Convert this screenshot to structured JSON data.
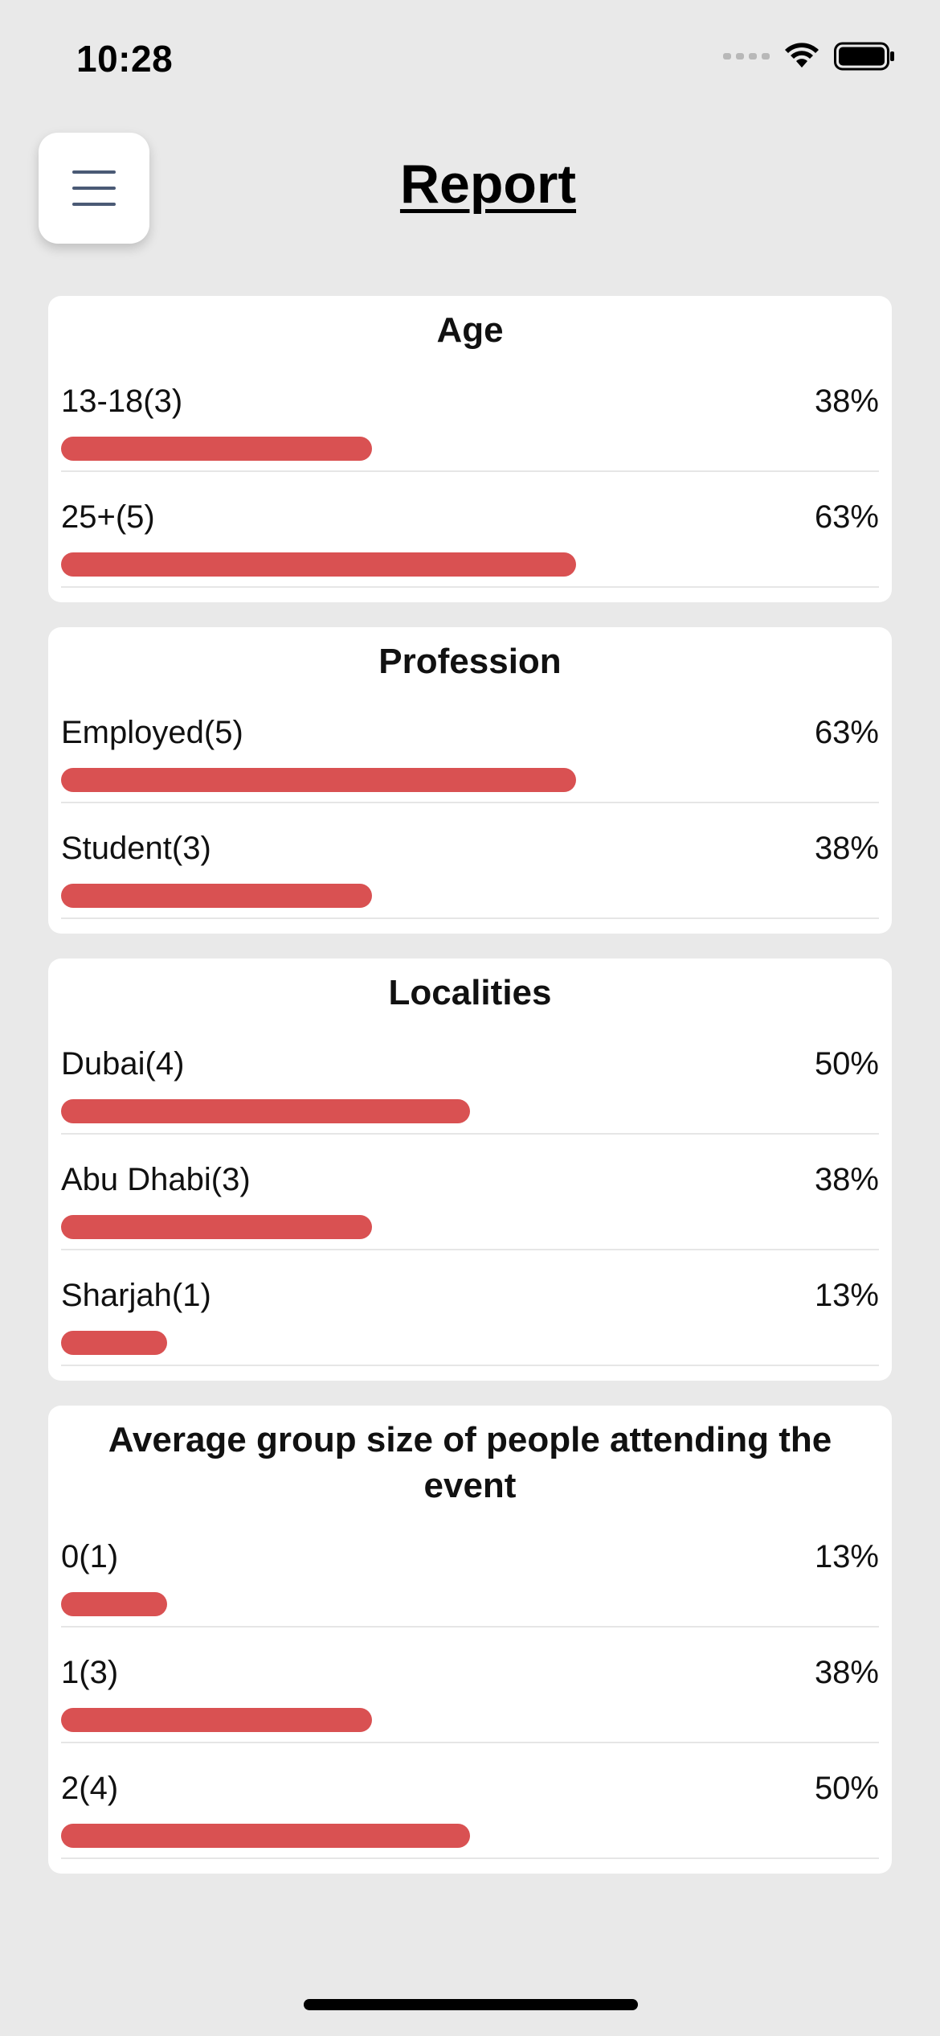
{
  "status_bar": {
    "time": "10:28"
  },
  "header": {
    "title": "Report",
    "menu_icon": "hamburger-menu-icon"
  },
  "colors": {
    "background": "#e9e9e9",
    "card": "#ffffff",
    "bar": "#d95152",
    "menu_icon": "#4a5a75"
  },
  "sections": [
    {
      "title": "Age",
      "rows": [
        {
          "label": "13-18(3)",
          "percent_text": "38%",
          "fraction": 0.38
        },
        {
          "label": "25+(5)",
          "percent_text": "63%",
          "fraction": 0.63
        }
      ]
    },
    {
      "title": "Profession",
      "rows": [
        {
          "label": "Employed(5)",
          "percent_text": "63%",
          "fraction": 0.63
        },
        {
          "label": "Student(3)",
          "percent_text": "38%",
          "fraction": 0.38
        }
      ]
    },
    {
      "title": "Localities",
      "rows": [
        {
          "label": "Dubai(4)",
          "percent_text": "50%",
          "fraction": 0.5
        },
        {
          "label": "Abu Dhabi(3)",
          "percent_text": "38%",
          "fraction": 0.38
        },
        {
          "label": "Sharjah(1)",
          "percent_text": "13%",
          "fraction": 0.13
        }
      ]
    },
    {
      "title": "Average group size of people attending the event",
      "rows": [
        {
          "label": "0(1)",
          "percent_text": "13%",
          "fraction": 0.13
        },
        {
          "label": "1(3)",
          "percent_text": "38%",
          "fraction": 0.38
        },
        {
          "label": "2(4)",
          "percent_text": "50%",
          "fraction": 0.5
        }
      ]
    }
  ]
}
